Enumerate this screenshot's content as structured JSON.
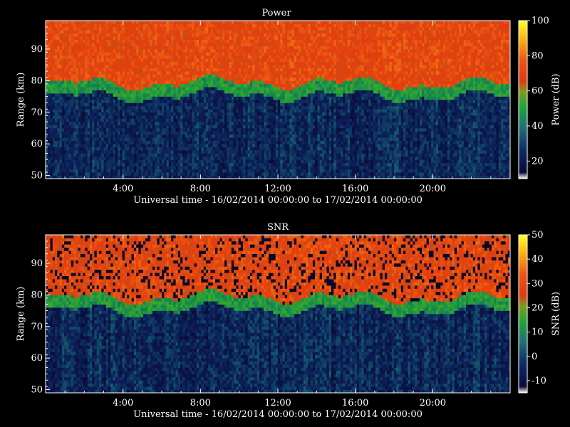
{
  "chart_data": [
    {
      "type": "heatmap",
      "title": "Power",
      "xlabel": "Universal time - 16/02/2014 00:00:00 to 17/02/2014 00:00:00",
      "ylabel": "Range (km)",
      "xlim": [
        "00:00",
        "24:00"
      ],
      "ylim": [
        49,
        99
      ],
      "x_ticks": [
        "4:00",
        "8:00",
        "12:00",
        "16:00",
        "20:00"
      ],
      "y_ticks": [
        50,
        60,
        70,
        80,
        90
      ],
      "colorbar": {
        "label": "Power (dB)",
        "range": [
          10,
          100
        ],
        "ticks": [
          20,
          40,
          60,
          80,
          100
        ]
      },
      "description_boundaries_km": {
        "noise_floor_below": 76,
        "strong_echo_above": 81
      }
    },
    {
      "type": "heatmap",
      "title": "SNR",
      "xlabel": "Universal time - 16/02/2014 00:00:00 to 17/02/2014 00:00:00",
      "ylabel": "Range (km)",
      "xlim": [
        "00:00",
        "24:00"
      ],
      "ylim": [
        49,
        99
      ],
      "x_ticks": [
        "4:00",
        "8:00",
        "12:00",
        "16:00",
        "20:00"
      ],
      "y_ticks": [
        50,
        60,
        70,
        80,
        90
      ],
      "colorbar": {
        "label": "SNR (dB)",
        "range": [
          -15,
          50
        ],
        "ticks": [
          -10,
          0,
          10,
          20,
          30,
          40,
          50
        ]
      },
      "description_boundaries_km": {
        "noise_floor_below": 76,
        "strong_echo_above": 81
      }
    }
  ]
}
